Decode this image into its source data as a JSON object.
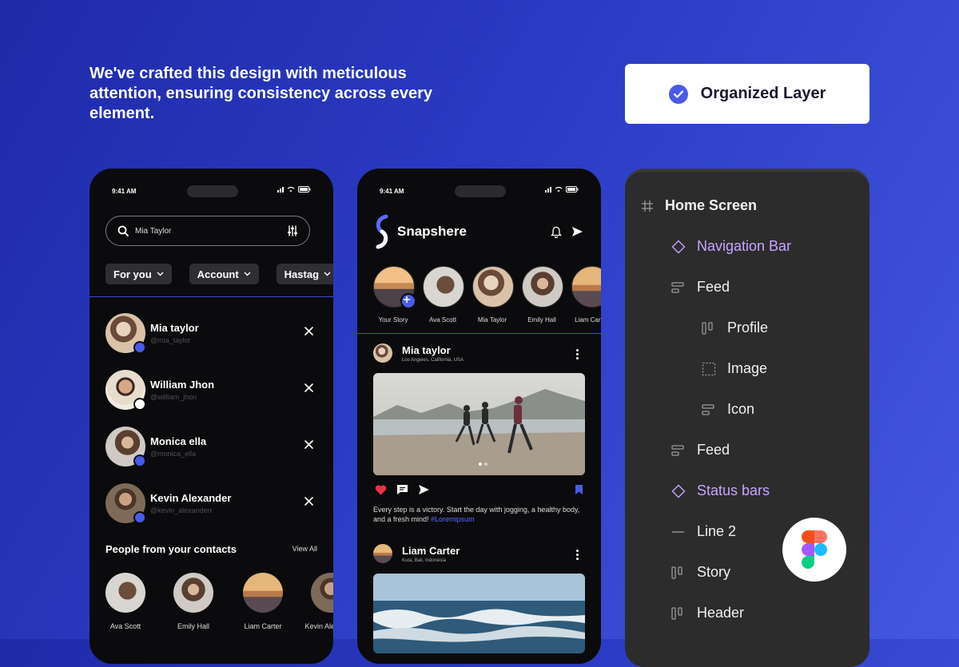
{
  "headline": "We've crafted this design with meticulous attention, ensuring consistency across every element.",
  "feature_badge": {
    "label": "Organized Layer"
  },
  "status_time": "9:41 AM",
  "search_screen": {
    "search_value": "Mia Taylor",
    "filters": [
      "For you",
      "Account",
      "Hastag"
    ],
    "recent": [
      {
        "name": "Mia taylor",
        "handle": "@mia_taylor",
        "online": true
      },
      {
        "name": "William Jhon",
        "handle": "@william_jhon",
        "online": false
      },
      {
        "name": "Monica ella",
        "handle": "@monica_ella",
        "online": true
      },
      {
        "name": "Kevin Alexander",
        "handle": "@kevin_alexanderr",
        "online": true
      }
    ],
    "contacts_title": "People from your contacts",
    "view_all": "View All",
    "contacts": [
      "Ava Scott",
      "Emily Hall",
      "Liam Carter",
      "Kevin Alexander"
    ]
  },
  "feed_screen": {
    "brand": "Snapshere",
    "stories": [
      "Your Story",
      "Ava Scott",
      "Mia Taylor",
      "Emily Hall",
      "Liam Carter"
    ],
    "post1": {
      "author": "Mia taylor",
      "location": "Los Angeles, California, USA",
      "caption": "Every step is a victory. Start the day with jogging, a healthy body, and a fresh mind!",
      "hashtag": "#Loremipsum"
    },
    "post2": {
      "author": "Liam Carter",
      "location": "Kuta, Bali, Indonesia"
    }
  },
  "layers": [
    {
      "label": "Home Screen",
      "icon": "frame-icon",
      "level": 0,
      "style": "bold"
    },
    {
      "label": "Navigation Bar",
      "icon": "component-icon",
      "level": 1,
      "style": "purple"
    },
    {
      "label": "Feed",
      "icon": "auto-layout-icon",
      "level": 1,
      "style": "normal"
    },
    {
      "label": "Profile",
      "icon": "auto-layout-horizontal-icon",
      "level": 2,
      "style": "normal"
    },
    {
      "label": "Image",
      "icon": "dashed-frame-icon",
      "level": 2,
      "style": "normal"
    },
    {
      "label": "Icon",
      "icon": "auto-layout-icon",
      "level": 2,
      "style": "normal"
    },
    {
      "label": "Feed",
      "icon": "auto-layout-icon",
      "level": 1,
      "style": "normal"
    },
    {
      "label": "Status bars",
      "icon": "component-icon",
      "level": 1,
      "style": "purple"
    },
    {
      "label": "Line 2",
      "icon": "line-icon",
      "level": 1,
      "style": "normal"
    },
    {
      "label": "Story",
      "icon": "auto-layout-horizontal-icon",
      "level": 1,
      "style": "normal"
    },
    {
      "label": "Header",
      "icon": "auto-layout-horizontal-icon",
      "level": 1,
      "style": "normal"
    }
  ],
  "colors": {
    "accent": "#4a5ae8",
    "background": "#0b0b0d",
    "component": "#c9a3ff",
    "panel": "#2c2c2c"
  }
}
